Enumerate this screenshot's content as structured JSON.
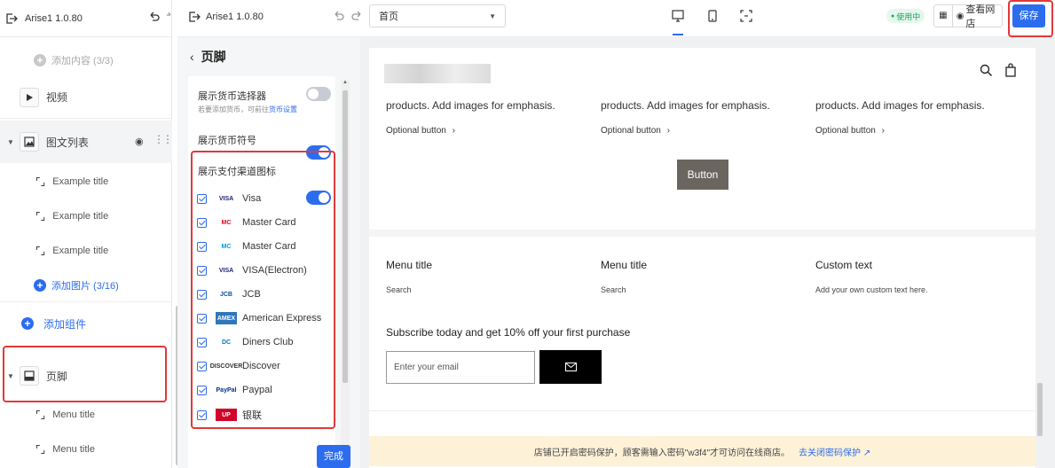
{
  "app": {
    "name": "Arise1 1.0.80"
  },
  "left": {
    "add_content": "添加内容 (3/3)",
    "video": "视频",
    "image_list": "图文列表",
    "items": [
      "Example title",
      "Example title",
      "Example title"
    ],
    "add_image": "添加图片 (3/16)",
    "add_component": "添加组件",
    "footer": "页脚",
    "menu_items": [
      "Menu title",
      "Menu title"
    ]
  },
  "toolbar": {
    "page_select": "首页",
    "status_badge": "使用中",
    "view_store": "查看网店",
    "save": "保存"
  },
  "panel": {
    "title": "页脚",
    "currency_selector": "展示货币选择器",
    "currency_hint": "若要添加货币，可前往",
    "currency_link": "货币设置",
    "currency_symbol": "展示货币符号",
    "payment_icons": "展示支付渠道图标",
    "done": "完成"
  },
  "payments": [
    {
      "logo": "VISA",
      "label": "Visa",
      "color": "#1a1f71",
      "bg": "#ffffff"
    },
    {
      "logo": "MC",
      "label": "Master Card",
      "color": "#eb001b",
      "bg": "#ffffff"
    },
    {
      "logo": "MC",
      "label": "Master Card",
      "color": "#0099df",
      "bg": "#ffffff"
    },
    {
      "logo": "VISA",
      "label": "VISA(Electron)",
      "color": "#1a1f71",
      "bg": "#ffffff"
    },
    {
      "logo": "JCB",
      "label": "JCB",
      "color": "#0b4ea2",
      "bg": "#ffffff"
    },
    {
      "logo": "AMEX",
      "label": "American Express",
      "color": "#ffffff",
      "bg": "#2e77bb"
    },
    {
      "logo": "DC",
      "label": "Diners Club",
      "color": "#0079be",
      "bg": "#ffffff"
    },
    {
      "logo": "DISCOVER",
      "label": "Discover",
      "color": "#333333",
      "bg": "#ffffff"
    },
    {
      "logo": "PayPal",
      "label": "Paypal",
      "color": "#003087",
      "bg": "#ffffff"
    },
    {
      "logo": "UP",
      "label": "银联",
      "color": "#ffffff",
      "bg": "#d10429"
    }
  ],
  "preview": {
    "cols": [
      {
        "text": "products. Add images for emphasis.",
        "btn": "Optional button"
      },
      {
        "text": "products. Add images for emphasis.",
        "btn": "Optional button"
      },
      {
        "text": "products. Add images for emphasis.",
        "btn": "Optional button"
      }
    ],
    "button": "Button",
    "footer_cols": [
      {
        "title": "Menu title",
        "item": "Search"
      },
      {
        "title": "Menu title",
        "item": "Search"
      },
      {
        "title": "Custom text",
        "item": "Add your own custom text here."
      }
    ],
    "subscribe_title": "Subscribe today and get 10% off your first purchase",
    "email_placeholder": "Enter your email",
    "notice": "店铺已开启密码保护，顾客需输入密码\"w3f4\"才可访问在线商店。",
    "notice_link": "去关闭密码保护"
  }
}
